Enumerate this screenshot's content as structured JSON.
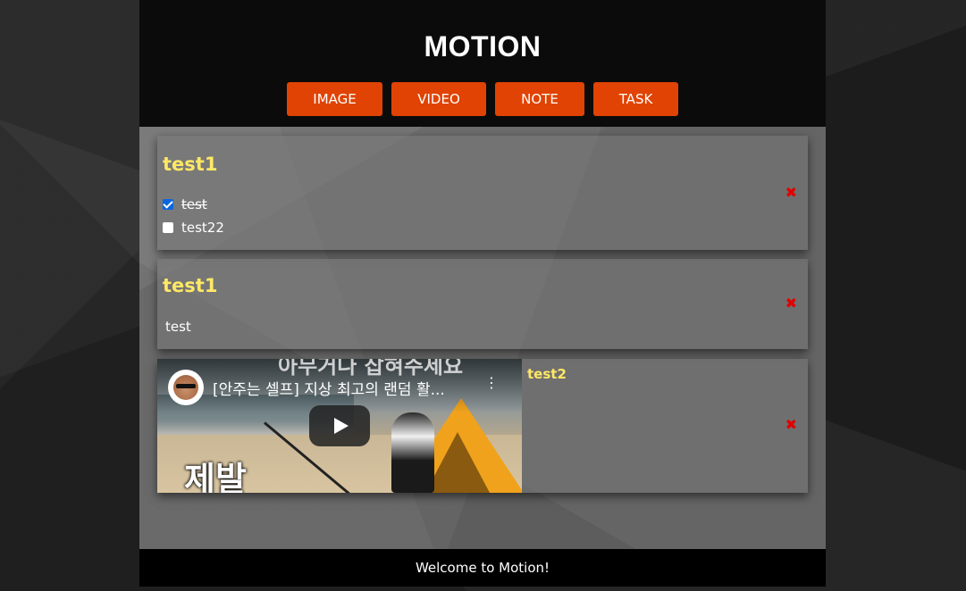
{
  "header": {
    "title": "MOTION",
    "buttons": {
      "image": "IMAGE",
      "video": "VIDEO",
      "note": "NOTE",
      "task": "TASK"
    }
  },
  "cards": {
    "task": {
      "title": "test1",
      "items": [
        {
          "label": "test",
          "checked": true
        },
        {
          "label": "test22",
          "checked": false
        }
      ],
      "close": "✖"
    },
    "note": {
      "title": "test1",
      "body": "test",
      "close": "✖"
    },
    "video": {
      "title": "test2",
      "video_title": "[안주는 셀프] 지상 최고의 랜덤 활...",
      "banner_text": "아무거나 잡혀주세요",
      "caption": "제발",
      "close": "✖"
    }
  },
  "footer": {
    "text": "Welcome to Motion!"
  },
  "colors": {
    "accent": "#e04303",
    "card_title": "#ffe866",
    "close": "#e00000"
  }
}
